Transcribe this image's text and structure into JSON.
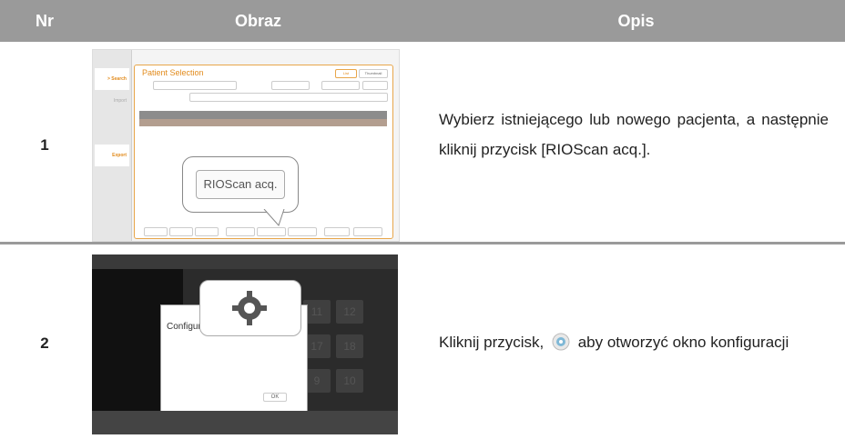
{
  "header": {
    "nr": "Nr",
    "obraz": "Obraz",
    "opis": "Opis"
  },
  "rows": [
    {
      "nr": "1",
      "opis": "Wybierz istniejącego lub nowego pacjenta, a następnie kliknij przycisk [RIOScan acq.]."
    },
    {
      "nr": "2",
      "opis_before": "Kliknij przycisk,",
      "opis_after": "aby otworzyć okno konfiguracji"
    }
  ],
  "shot1": {
    "title": "Patient Selection",
    "sidebar": [
      "> Search",
      "Import",
      "Export"
    ],
    "callout_button": "RIOScan acq.",
    "bottom_buttons": [
      "New",
      "Modify",
      "Delete",
      "Sensor acq.",
      "RIOScan acq.",
      "IO Cam acq.",
      "Export",
      "Open"
    ],
    "columns": [
      "ID",
      "Name",
      "Gender",
      "DOB",
      "Intraoral",
      "Other"
    ]
  },
  "shot2": {
    "dialog_title": "Configuratio",
    "numbers": [
      "11",
      "12",
      "17",
      "18",
      "9",
      "10"
    ],
    "ok": "OK"
  },
  "icons": {
    "gear": "gear-icon"
  }
}
